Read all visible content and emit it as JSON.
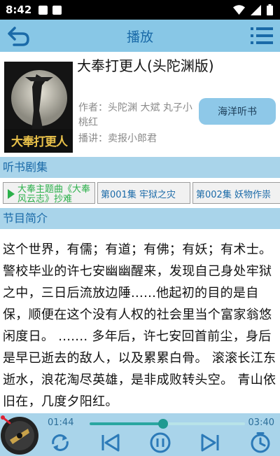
{
  "status_bar": {
    "time": "8:42"
  },
  "app_bar": {
    "title": "播放",
    "back_icon": "back-arrow-icon",
    "menu_icon": "list-menu-icon"
  },
  "book": {
    "cover_title": "大奉打更人",
    "title": "大奉打更人(头陀渊版)",
    "author": "作者：头陀渊 大斌 丸子小桃红",
    "narrator": "播讲：卖报小郎君",
    "source_button": "海洋听书"
  },
  "episodes_section": {
    "heading": "听书剧集",
    "items": [
      {
        "label": "大奉主题曲《大奉风云志》抄难",
        "active": true
      },
      {
        "label": "第001集 牢狱之灾",
        "active": false
      },
      {
        "label": "第002集 妖物作祟",
        "active": false
      }
    ]
  },
  "intro_section": {
    "heading": "节目简介",
    "text": "这个世界，有儒；有道；有佛；有妖；有术士。 警校毕业的许七安幽幽醒来，发现自己身处牢狱之中，三日后流放边陲......他起初的目的是自保，顺便在这个没有人权的社会里当个富家翁悠闲度日。 ....... 多年后，许七安回首前尘，身后是早已逝去的敌人，以及累累白骨。 滚滚长江东逝水，浪花淘尽英雄，是非成败转头空。 青山依旧在，几度夕阳红。"
  },
  "player": {
    "current_time": "01:44",
    "total_time": "03:40",
    "progress_fraction": 0.4727,
    "icons": [
      "loop-icon",
      "previous-icon",
      "pause-icon",
      "next-icon",
      "timer-icon"
    ]
  },
  "colors": {
    "app_bar": "#88c7e6",
    "section_header": "#a9d4ea",
    "accent_blue": "#1a6aa8",
    "active_green": "#2bb04a",
    "progress": "#2aa6a0"
  }
}
